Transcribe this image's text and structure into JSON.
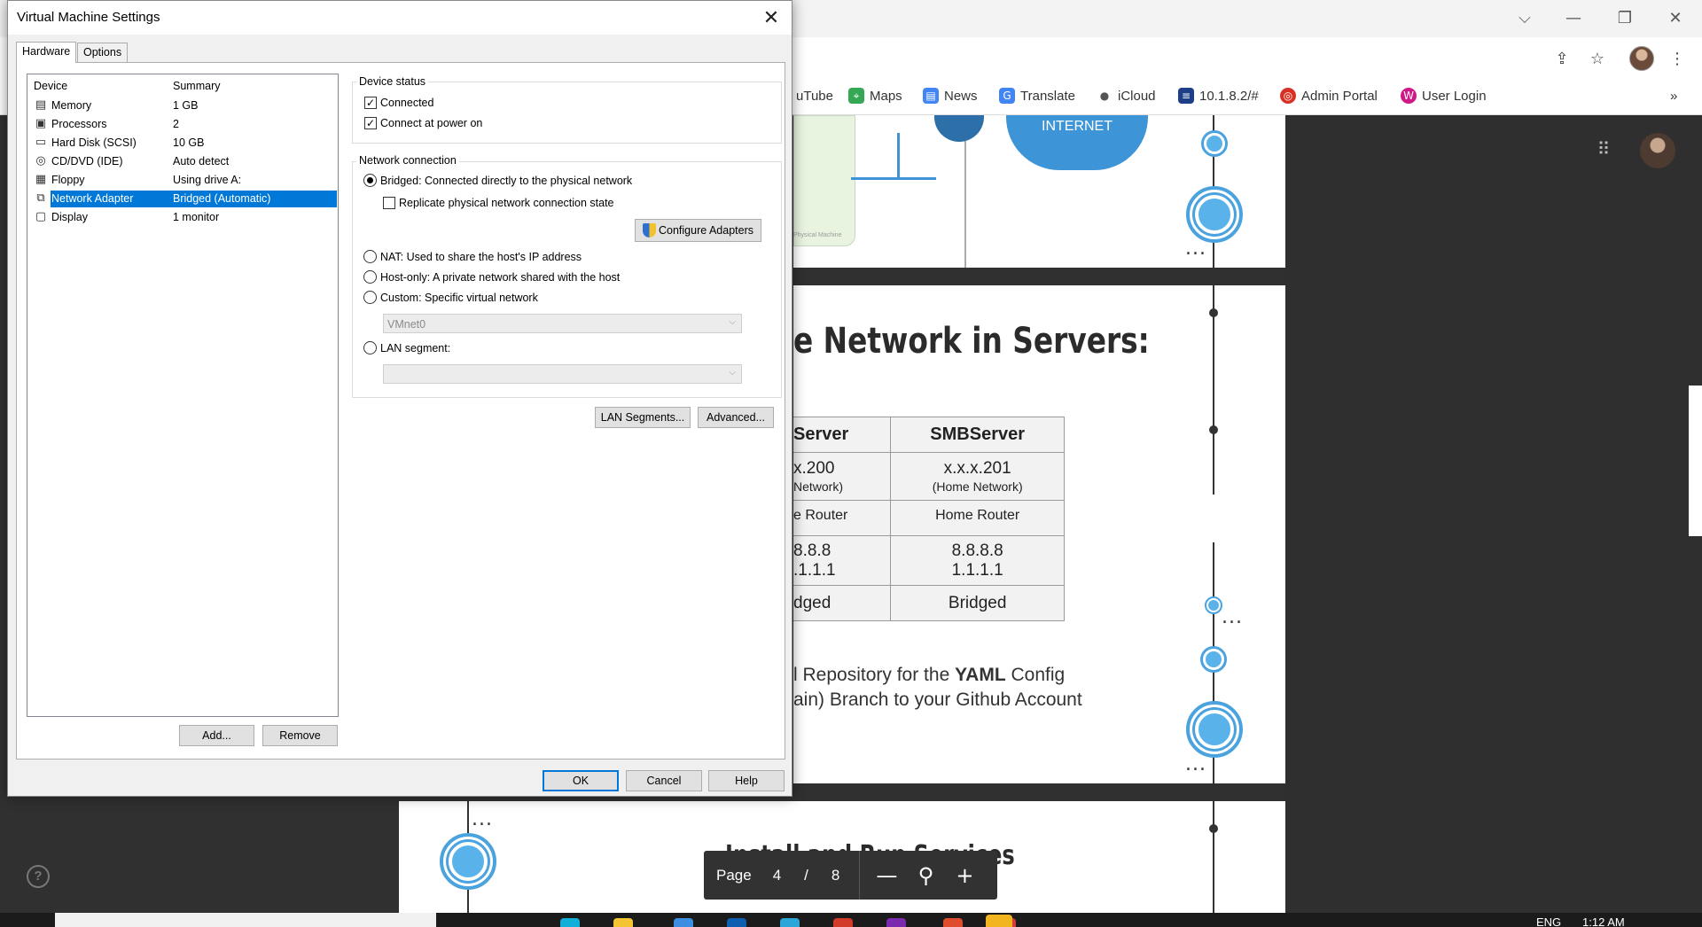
{
  "browser": {
    "window_controls": {
      "chevron": "⌵",
      "minimize": "—",
      "restore": "❐",
      "close": "✕"
    },
    "bookmarks": [
      {
        "label": "uTube",
        "icon": "youtube-icon",
        "color": "#ff0000"
      },
      {
        "label": "Maps",
        "icon": "maps-icon",
        "color": "#34a853"
      },
      {
        "label": "News",
        "icon": "news-icon",
        "color": "#4285f4"
      },
      {
        "label": "Translate",
        "icon": "translate-icon",
        "color": "#4285f4"
      },
      {
        "label": "iCloud",
        "icon": "apple-icon",
        "color": "#555555"
      },
      {
        "label": "10.1.8.2/#",
        "icon": "server-icon",
        "color": "#1d3f8a"
      },
      {
        "label": "Admin Portal",
        "icon": "portal-icon",
        "color": "#d93025"
      },
      {
        "label": "User Login",
        "icon": "login-icon",
        "color": "#d01886"
      }
    ],
    "overflow": "»"
  },
  "page": {
    "diagram_label": "INTERNET",
    "physical_machine_label": "Physical Machine",
    "heading": "e Network in Servers:",
    "table": {
      "headers": [
        "Server",
        "SMBServer"
      ],
      "rows": [
        [
          {
            "big": "x.200",
            "small": "Network)"
          },
          {
            "big": "x.x.x.201",
            "small": "(Home Network)"
          }
        ],
        [
          {
            "big": "e Router",
            "small": ""
          },
          {
            "big": "Home Router",
            "small": ""
          }
        ],
        [
          {
            "big": "8.8.8",
            "big2": ".1.1.1"
          },
          {
            "big": "8.8.8.8",
            "big2": "1.1.1.1"
          }
        ],
        [
          {
            "big": "dged",
            "small": ""
          },
          {
            "big": "Bridged",
            "small": ""
          }
        ]
      ]
    },
    "yaml_line1_pre": "l Repository for the ",
    "yaml_line1_bold": "YAML",
    "yaml_line1_post": " Config",
    "yaml_line2": "ain) Branch to your Github Account",
    "slide3_heading": "Install and Run Services",
    "ellipsis": "..."
  },
  "pdf_toolbar": {
    "page_label": "Page",
    "current_page": "4",
    "separator": "/",
    "total_pages": "8",
    "zoom_out": "—",
    "zoom_fit_icon": "⚲",
    "zoom_in": "+"
  },
  "taskbar": {
    "lang": "ENG",
    "time": "1:12 AM"
  },
  "dialog": {
    "title": "Virtual Machine Settings",
    "close": "✕",
    "tabs": [
      "Hardware",
      "Options"
    ],
    "device_list": {
      "col_device": "Device",
      "col_summary": "Summary",
      "rows": [
        {
          "name": "Memory",
          "summary": "1 GB",
          "icon": "memory-icon",
          "glyph": "▤"
        },
        {
          "name": "Processors",
          "summary": "2",
          "icon": "processor-icon",
          "glyph": "▣"
        },
        {
          "name": "Hard Disk (SCSI)",
          "summary": "10 GB",
          "icon": "hard-disk-icon",
          "glyph": "▭"
        },
        {
          "name": "CD/DVD (IDE)",
          "summary": "Auto detect",
          "icon": "cd-dvd-icon",
          "glyph": "◎"
        },
        {
          "name": "Floppy",
          "summary": "Using drive A:",
          "icon": "floppy-icon",
          "glyph": "▦"
        },
        {
          "name": "Network Adapter",
          "summary": "Bridged (Automatic)",
          "icon": "network-adapter-icon",
          "glyph": "⧉",
          "selected": true
        },
        {
          "name": "Display",
          "summary": "1 monitor",
          "icon": "display-icon",
          "glyph": "▢"
        }
      ]
    },
    "add_label": "Add...",
    "remove_label": "Remove",
    "device_status": {
      "title": "Device status",
      "connected": "Connected",
      "connected_checked": true,
      "connect_power_on": "Connect at power on",
      "connect_power_on_checked": true
    },
    "network_connection": {
      "title": "Network connection",
      "bridged": "Bridged: Connected directly to the physical network",
      "replicate": "Replicate physical network connection state",
      "configure_adapters": "Configure Adapters",
      "nat": "NAT: Used to share the host's IP address",
      "host_only": "Host-only: A private network shared with the host",
      "custom": "Custom: Specific virtual network",
      "custom_value": "VMnet0",
      "lan_segment": "LAN segment:",
      "lan_segment_value": "",
      "selected": "bridged"
    },
    "lan_segments_label": "LAN Segments...",
    "advanced_label": "Advanced...",
    "ok_label": "OK",
    "cancel_label": "Cancel",
    "help_label": "Help"
  }
}
